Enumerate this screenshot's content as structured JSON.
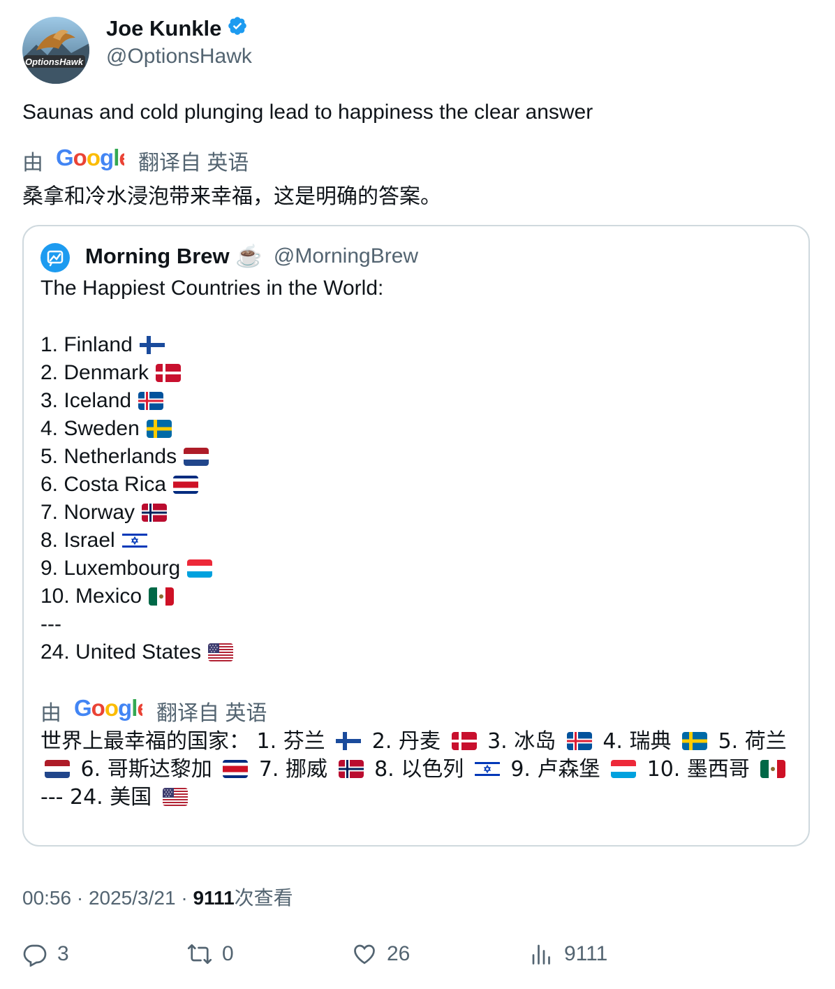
{
  "author": {
    "display_name": "Joe Kunkle",
    "handle": "@OptionsHawk",
    "avatar_text": "OptionsHawk"
  },
  "tweet": {
    "text": "Saunas and cold plunging lead to happiness the clear answer",
    "translate_prefix": "由",
    "translate_suffix": "翻译自 英语",
    "translated_text": "桑拿和冷水浸泡带来幸福，这是明确的答案。"
  },
  "quote": {
    "display_name": "Morning Brew ☕️",
    "handle": "@MorningBrew",
    "title": "The Happiest Countries in the World:",
    "countries": [
      {
        "label": "1. Finland",
        "flag": "fi"
      },
      {
        "label": "2. Denmark",
        "flag": "dk"
      },
      {
        "label": "3. Iceland",
        "flag": "is"
      },
      {
        "label": "4. Sweden",
        "flag": "se"
      },
      {
        "label": "5. Netherlands",
        "flag": "nl"
      },
      {
        "label": "6. Costa Rica",
        "flag": "cr"
      },
      {
        "label": "7. Norway",
        "flag": "no"
      },
      {
        "label": "8. Israel",
        "flag": "il"
      },
      {
        "label": "9. Luxembourg",
        "flag": "lu"
      },
      {
        "label": "10. Mexico",
        "flag": "mx"
      },
      {
        "label": "---",
        "flag": ""
      },
      {
        "label": "24. United States",
        "flag": "us"
      }
    ],
    "translate_prefix": "由",
    "translate_suffix": "翻译自 英语",
    "translated_items": [
      {
        "text": "世界上最幸福的国家： 1. 芬兰",
        "flag": "fi"
      },
      {
        "text": "2. 丹麦",
        "flag": "dk"
      },
      {
        "text": "3. 冰岛",
        "flag": "is"
      },
      {
        "text": "4. 瑞典",
        "flag": "se"
      },
      {
        "text": "5. 荷兰",
        "flag": "nl"
      },
      {
        "text": "6. 哥斯达黎加",
        "flag": "cr"
      },
      {
        "text": "7. 挪威",
        "flag": "no"
      },
      {
        "text": "8. 以色列",
        "flag": "il"
      },
      {
        "text": "9. 卢森堡",
        "flag": "lu"
      },
      {
        "text": "10. 墨西哥",
        "flag": "mx"
      },
      {
        "text": "--- 24. 美国",
        "flag": "us"
      }
    ]
  },
  "meta": {
    "time": "00:56",
    "date": "2025/3/21",
    "views_count": "9111",
    "views_label": "次查看"
  },
  "actions": {
    "replies": "3",
    "reposts": "0",
    "likes": "26",
    "views": "9111"
  },
  "icons": {
    "verified": "verified-badge-icon",
    "reply": "reply-icon",
    "repost": "repost-icon",
    "like": "heart-icon",
    "views": "bar-chart-icon"
  },
  "colors": {
    "verified_blue": "#1d9bf0",
    "text_secondary": "#536471",
    "text_primary": "#0f1419",
    "border": "#cfd9de"
  }
}
